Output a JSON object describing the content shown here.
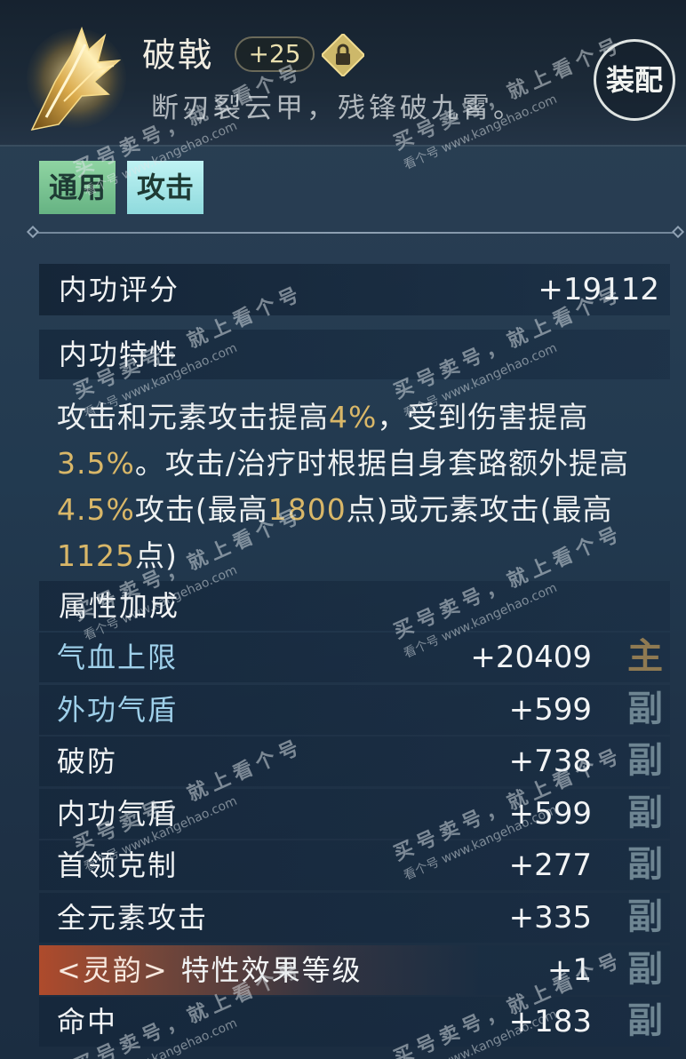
{
  "item": {
    "name": "破戟",
    "level": "+25",
    "description": "断刃裂云甲，残锋破九霄。",
    "icon": "golden-spear-icon",
    "lock_icon": "lock-icon",
    "equip_label": "装配"
  },
  "tags": [
    "通用",
    "攻击"
  ],
  "score": {
    "label": "内功评分",
    "value": "+19112"
  },
  "trait": {
    "title": "内功特性",
    "segments": [
      {
        "text": "攻击和元素攻击提高",
        "highlight": false
      },
      {
        "text": "4%",
        "highlight": true
      },
      {
        "text": "，受到伤害提高",
        "highlight": false
      },
      {
        "text": "3.5%",
        "highlight": true
      },
      {
        "text": "。攻击/治疗时根据自身套路额外提高",
        "highlight": false
      },
      {
        "text": "4.5%",
        "highlight": true
      },
      {
        "text": "攻击(最高",
        "highlight": false
      },
      {
        "text": "1800",
        "highlight": true
      },
      {
        "text": "点)或元素攻击(最高",
        "highlight": false
      },
      {
        "text": "1125",
        "highlight": true
      },
      {
        "text": "点)",
        "highlight": false
      }
    ]
  },
  "attributes": {
    "title": "属性加成",
    "rows": [
      {
        "label": "气血上限",
        "value": "+20409",
        "marker": "主"
      },
      {
        "label": "外功气盾",
        "value": "+599",
        "marker": "副"
      },
      {
        "label": "破防",
        "value": "+738",
        "marker": "副"
      },
      {
        "label": "内功气盾",
        "value": "+599",
        "marker": "副"
      },
      {
        "label": "首领克制",
        "value": "+277",
        "marker": "副"
      },
      {
        "label": "全元素攻击",
        "value": "+335",
        "marker": "副"
      },
      {
        "prefix": "<灵韵>",
        "label": "特性效果等级",
        "value": "+1",
        "marker": "副"
      },
      {
        "label": "命中",
        "value": "+183",
        "marker": "副"
      }
    ]
  },
  "watermark": {
    "line1": "买号卖号，就上看个号",
    "line2": "看个号 www.kangehao.com"
  },
  "colors": {
    "highlight": "#d9b768",
    "tag_general": "#7cc793",
    "tag_attack": "#a9e8ea",
    "label_blue": "#9fd0ea",
    "lingyun_accent": "#d0582c"
  }
}
